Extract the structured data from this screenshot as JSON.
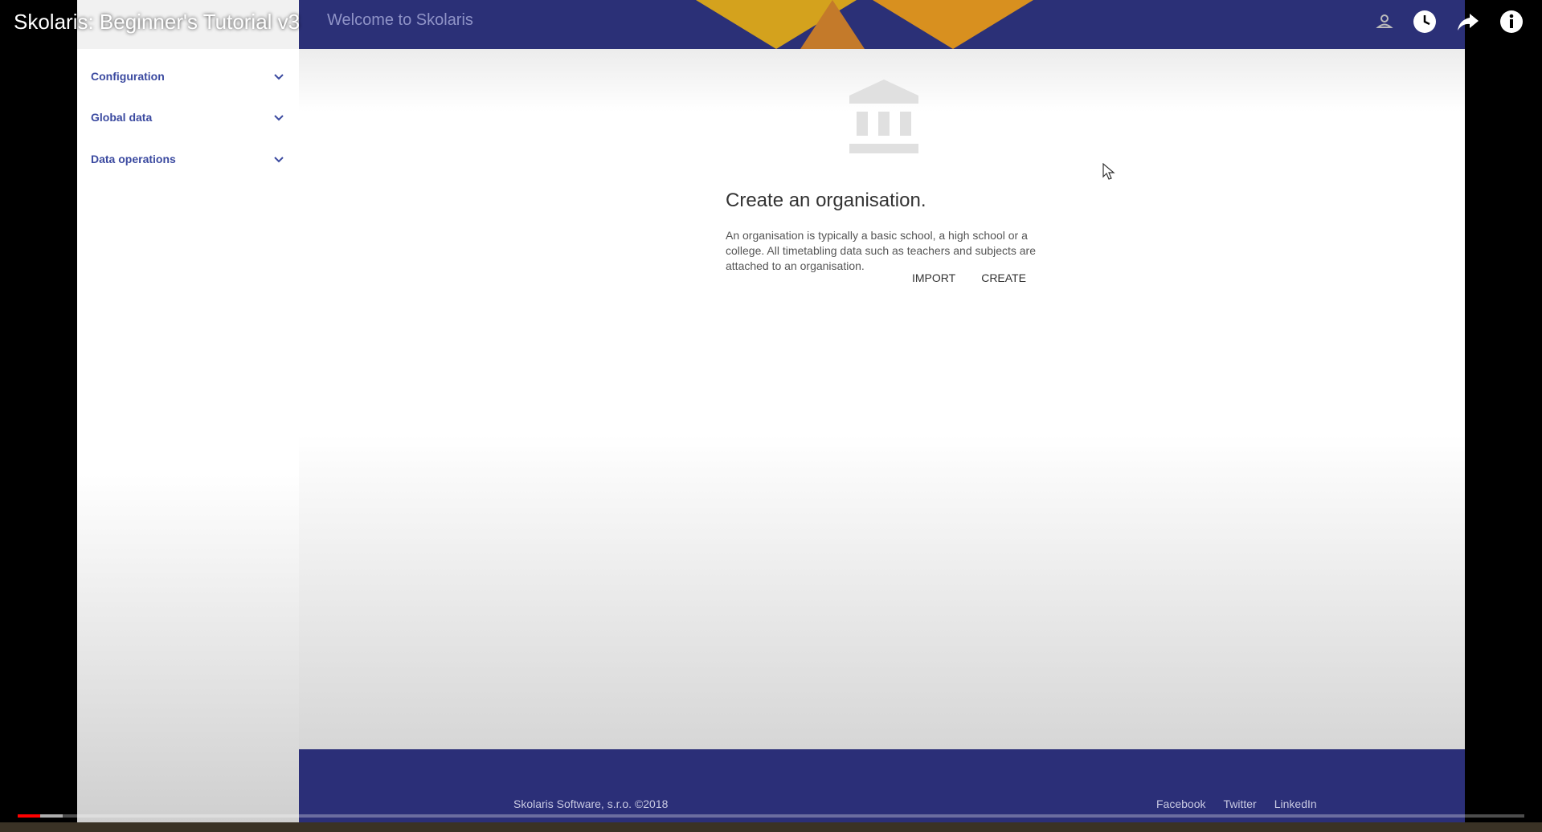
{
  "player": {
    "video_title": "Skolaris: Beginner's Tutorial v3",
    "played_fraction": 0.015,
    "buffered_fraction": 0.03,
    "icons": [
      "account-icon",
      "watch-later-icon",
      "share-icon",
      "info-icon"
    ]
  },
  "app": {
    "page_heading": "Welcome to Skolaris",
    "colors": {
      "topbar": "#2b3077",
      "accent": "#3b4aa0",
      "footer": "#2b2f78"
    },
    "sidebar": {
      "items": [
        {
          "label": "Configuration"
        },
        {
          "label": "Global data"
        },
        {
          "label": "Data operations"
        }
      ]
    },
    "card": {
      "title": "Create an organisation.",
      "body": "An organisation is typically a basic school, a high school or a college. All timetabling data such as teachers and subjects are attached to an organisation.",
      "import_label": "IMPORT",
      "create_label": "CREATE"
    },
    "footer": {
      "copyright": "Skolaris Software, s.r.o. ©2018",
      "links": [
        "Facebook",
        "Twitter",
        "LinkedIn"
      ]
    }
  }
}
